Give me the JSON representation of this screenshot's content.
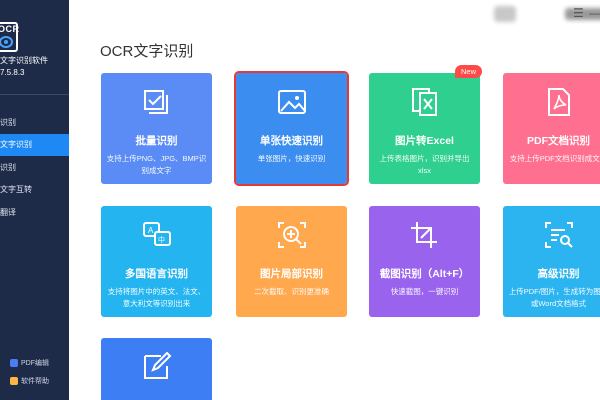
{
  "sidebar": {
    "logo_text": "OCR",
    "app_name": "文字识别软件",
    "version": "7.5.8.3",
    "items": [
      {
        "label": "识别"
      },
      {
        "label": "文字识别"
      },
      {
        "label": "识别"
      },
      {
        "label": "文字互转"
      },
      {
        "label": "翻译"
      }
    ],
    "bottom": [
      {
        "label": "PDF编辑"
      },
      {
        "label": "软件帮助"
      }
    ]
  },
  "topbar": {
    "menu_icon": "☰",
    "minimize_icon": "—"
  },
  "main": {
    "title": "OCR文字识别",
    "cards": [
      {
        "title": "批量识别",
        "desc": "支持上传PNG、JPG、BMP识别成文字",
        "icon": "batch-image-icon"
      },
      {
        "title": "单张快速识别",
        "desc": "单张图片，快速识别",
        "icon": "image-icon"
      },
      {
        "title": "图片转Excel",
        "desc": "上传表格图片，识别并导出xlsx",
        "icon": "excel-icon",
        "badge": "New"
      },
      {
        "title": "PDF文档识别",
        "desc": "支持上传PDF文档识别成文字",
        "icon": "pdf-icon"
      },
      {
        "title": "多国语言识别",
        "desc": "支持将图片中的英文、法文、意大利文等识别出来",
        "icon": "translate-icon"
      },
      {
        "title": "图片局部识别",
        "desc": "二次截取、识别更准确",
        "icon": "zoom-in-icon"
      },
      {
        "title": "截图识别（Alt+F）",
        "desc": "快速截图，一键识别",
        "icon": "crop-icon"
      },
      {
        "title": "高级识别",
        "desc": "上传PDF/图片，生成转为图片或Word文档格式",
        "icon": "scan-search-icon"
      },
      {
        "title": "",
        "desc": "",
        "icon": "edit-icon"
      }
    ]
  },
  "colors": {
    "sidebar": "#1e2b48",
    "active": "#1e88f5",
    "card_blue": "#5b8cf5",
    "card_selected_blue": "#3b8ef0",
    "card_green": "#2fcf8f",
    "card_pink": "#ff6f8f",
    "card_cyan": "#24b5f1",
    "card_orange": "#ffa84d",
    "card_purple": "#9a63ee",
    "card_sky": "#2cb4f0",
    "card_royal": "#3d7ef5"
  }
}
